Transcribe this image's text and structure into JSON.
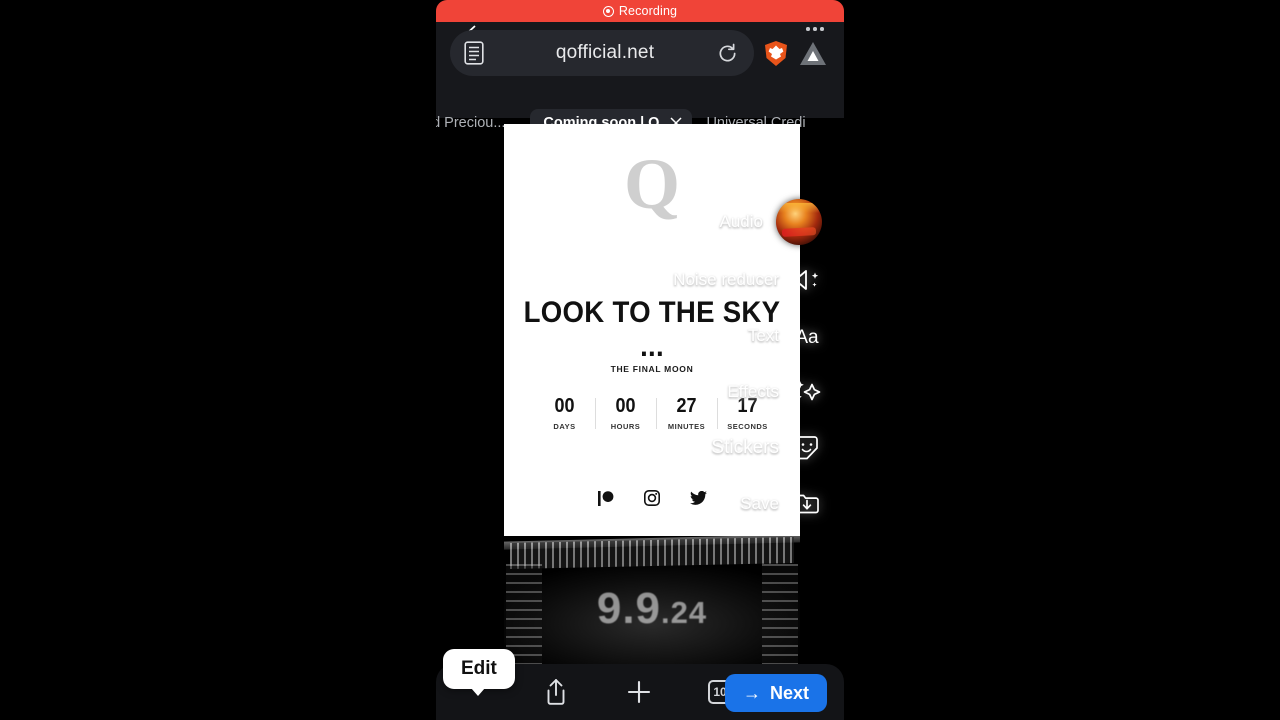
{
  "recording": {
    "label": "Recording",
    "banner_color": "#f04438",
    "icon": "record-dot-icon"
  },
  "browser": {
    "back_icon": "back-chevron-icon",
    "reader_icon": "reader-mode-icon",
    "url": "qofficial.net",
    "reload_icon": "reload-icon",
    "shield_icon": "brave-shield-icon",
    "profile_icon": "profile-triangle-icon",
    "menu_icon": "kebab-menu-icon",
    "tabs": [
      {
        "label": "nd Preciou...",
        "active": false
      },
      {
        "label": "Coming soon | Q",
        "active": true,
        "close_icon": "close-icon"
      },
      {
        "label": "Universal Credi",
        "active": false
      }
    ]
  },
  "page": {
    "logo": "Q",
    "headline": "LOOK TO THE SKY ...",
    "subhead": "THE FINAL MOON",
    "countdown": [
      {
        "value": "00",
        "label": "DAYS"
      },
      {
        "value": "00",
        "label": "HOURS"
      },
      {
        "value": "27",
        "label": "MINUTES"
      },
      {
        "value": "17",
        "label": "SECONDS"
      }
    ],
    "socials": [
      {
        "name": "patreon-icon"
      },
      {
        "name": "instagram-icon"
      },
      {
        "name": "twitter-icon"
      }
    ],
    "photo": {
      "date_text": "9.9",
      "date_suffix": ".24"
    }
  },
  "editor_overlay": {
    "items": [
      {
        "label": "Audio",
        "icon": "album-art-thumbnail"
      },
      {
        "label": "Noise reducer",
        "icon": "speaker-sparkle-icon"
      },
      {
        "label": "Text",
        "icon": "text-aa-icon"
      },
      {
        "label": "Effects",
        "icon": "sparkles-icon"
      },
      {
        "label": "Stickers",
        "icon": "sticker-face-icon"
      },
      {
        "label": "Save",
        "icon": "save-folder-down-icon"
      }
    ]
  },
  "bottom_bar": {
    "tooltip": "Edit",
    "share_icon": "share-icon",
    "new_tab_icon": "plus-icon",
    "tab_count": "10",
    "next_label": "Next",
    "next_arrow": "→",
    "next_color": "#1a73e8"
  }
}
